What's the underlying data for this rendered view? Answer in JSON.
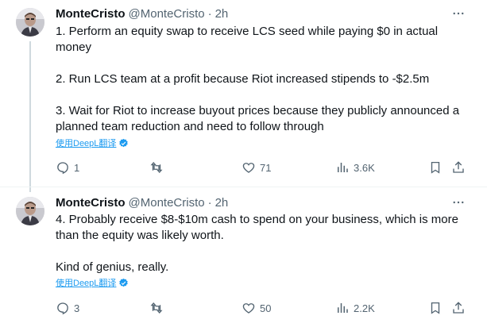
{
  "thread": [
    {
      "author": {
        "name": "MonteCristo",
        "handle": "@MonteCristo",
        "separator": "·",
        "time": "2h"
      },
      "text": "1. Perform an equity swap to receive LCS seed while paying $0 in actual money\n\n2. Run LCS team at a profit because Riot increased stipends to -$2.5m\n\n3. Wait for Riot to increase buyout prices because they publicly announced a planned team reduction and need to follow through",
      "translate_label": "使用DeepL翻译",
      "stats": {
        "replies": "1",
        "retweets": "",
        "likes": "71",
        "views": "3.6K"
      }
    },
    {
      "author": {
        "name": "MonteCristo",
        "handle": "@MonteCristo",
        "separator": "·",
        "time": "2h"
      },
      "text": "4. Probably receive $8-$10m cash to spend on your business, which is more than the equity was likely worth.\n\nKind of genius, really.",
      "translate_label": "使用DeepL翻译",
      "stats": {
        "replies": "3",
        "retweets": "",
        "likes": "50",
        "views": "2.2K"
      }
    }
  ],
  "colors": {
    "text": "#0f1419",
    "secondary": "#536471",
    "link": "#1d9bf0",
    "thread_line": "#cfd9de"
  },
  "icons": [
    "more-icon",
    "reply-icon",
    "retweet-icon",
    "like-icon",
    "views-icon",
    "bookmark-icon",
    "share-icon",
    "deepl-badge-icon"
  ]
}
